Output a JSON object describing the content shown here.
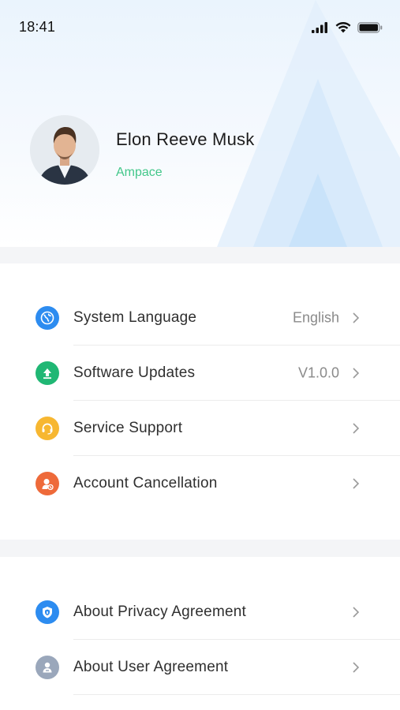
{
  "status_bar": {
    "time": "18:41"
  },
  "profile": {
    "name": "Elon Reeve Musk",
    "company": "Ampace"
  },
  "settings": [
    {
      "label": "System Language",
      "value": "English",
      "icon": "globe-icon",
      "color": "#2d8cf0"
    },
    {
      "label": "Software Updates",
      "value": "V1.0.0",
      "icon": "upload-icon",
      "color": "#20b774"
    },
    {
      "label": "Service Support",
      "value": "",
      "icon": "headset-icon",
      "color": "#f7b731"
    },
    {
      "label": "Account Cancellation",
      "value": "",
      "icon": "user-remove-icon",
      "color": "#ee6a3a"
    }
  ],
  "about": [
    {
      "label": "About Privacy Agreement",
      "icon": "shield-icon",
      "color": "#2d8cf0"
    },
    {
      "label": "About User Agreement",
      "icon": "user-doc-icon",
      "color": "#9aa7bb"
    }
  ]
}
